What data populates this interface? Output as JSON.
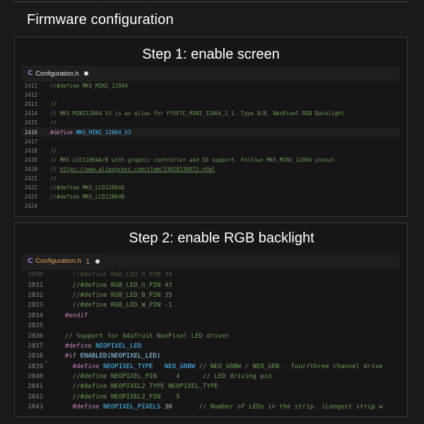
{
  "page": {
    "title": "Firmware configuration"
  },
  "steps": [
    {
      "title": "Step 1: enable screen",
      "tab": {
        "icon": "C",
        "filename": "Configuration.h",
        "problems": "",
        "unsaved": true
      },
      "lines": [
        {
          "n": "2411",
          "segs": [
            {
              "t": "//#define MKS_MINI_12864",
              "c": "c-com"
            }
          ]
        },
        {
          "n": "2412",
          "segs": []
        },
        {
          "n": "2413",
          "segs": [
            {
              "t": "//",
              "c": "c-com"
            }
          ]
        },
        {
          "n": "2414",
          "segs": [
            {
              "t": "// MKS MINI12864 V3 is an alias for FYSETC_MINI_12864_2_1. Type A/B. NeoPixel RGB Backlight.",
              "c": "c-com"
            }
          ]
        },
        {
          "n": "2415",
          "segs": [
            {
              "t": "//",
              "c": "c-com"
            }
          ]
        },
        {
          "n": "2416",
          "current": true,
          "modified": true,
          "segs": [
            {
              "t": "#define ",
              "c": "c-pp"
            },
            {
              "t": "MKS_MINI_12864_V3",
              "c": "c-mac"
            }
          ]
        },
        {
          "n": "2417",
          "segs": []
        },
        {
          "n": "2418",
          "segs": [
            {
              "t": "//",
              "c": "c-com"
            }
          ]
        },
        {
          "n": "2419",
          "segs": [
            {
              "t": "// MKS LCD12864A/B with graphic controller and SD support. Follows MKS_MINI_12864 pinout.",
              "c": "c-com"
            }
          ]
        },
        {
          "n": "2420",
          "segs": [
            {
              "t": "// ",
              "c": "c-com"
            },
            {
              "t": "https://www.aliexpress.com/item/33018110072.html",
              "c": "c-link"
            }
          ]
        },
        {
          "n": "2421",
          "segs": [
            {
              "t": "//",
              "c": "c-com"
            }
          ]
        },
        {
          "n": "2422",
          "segs": [
            {
              "t": "//#define MKS_LCD12864A",
              "c": "c-com"
            }
          ]
        },
        {
          "n": "2423",
          "segs": [
            {
              "t": "//#define MKS_LCD12864B",
              "c": "c-com"
            }
          ]
        },
        {
          "n": "2424",
          "segs": []
        },
        {
          "n": "",
          "segs": [
            {
              "t": "..",
              "c": "c-ell"
            }
          ]
        }
      ]
    },
    {
      "title": "Step 2: enable RGB backlight",
      "tab": {
        "icon": "C",
        "filename": "Configuration.h",
        "problems": "1",
        "unsaved": true
      },
      "lines": [
        {
          "n": "2830",
          "dim": true,
          "segs": [
            {
              "t": "    //#define RGB_LED_R_PIN 34",
              "c": "c-com"
            }
          ]
        },
        {
          "n": "2831",
          "segs": [
            {
              "t": "    //#define RGB_LED_G_PIN 43",
              "c": "c-com"
            }
          ]
        },
        {
          "n": "2832",
          "segs": [
            {
              "t": "    //#define RGB_LED_B_PIN 35",
              "c": "c-com"
            }
          ]
        },
        {
          "n": "2833",
          "error": true,
          "segs": [
            {
              "t": "    //#define RGB_LED_W_PIN -1",
              "c": "c-com"
            }
          ]
        },
        {
          "n": "2834",
          "segs": [
            {
              "t": "  #endif",
              "c": "c-pp"
            }
          ]
        },
        {
          "n": "2835",
          "segs": []
        },
        {
          "n": "2836",
          "segs": [
            {
              "t": "  // Support for Adafruit NeoPixel LED driver",
              "c": "c-com"
            }
          ]
        },
        {
          "n": "2837",
          "modified": true,
          "segs": [
            {
              "t": "  #define ",
              "c": "c-pp"
            },
            {
              "t": "NEOPIXEL_LED",
              "c": "c-mac"
            }
          ]
        },
        {
          "n": "2838",
          "fold": true,
          "segs": [
            {
              "t": "  #if ",
              "c": "c-pp"
            },
            {
              "t": "ENABLED(NEOPIXEL_LED)",
              "c": "c-id"
            }
          ]
        },
        {
          "n": "2839",
          "segs": [
            {
              "t": "    #define ",
              "c": "c-pp"
            },
            {
              "t": "NEOPIXEL_TYPE   NEO_GRBW",
              "c": "c-mac"
            },
            {
              "t": " // NEO_GRBW / NEO_GRB - four/three channel drive",
              "c": "c-com"
            }
          ]
        },
        {
          "n": "2840",
          "segs": [
            {
              "t": "    //#define NEOPIXEL_PIN     4      // LED driving pin",
              "c": "c-com"
            }
          ]
        },
        {
          "n": "2841",
          "segs": [
            {
              "t": "    //#define NEOPIXEL2_TYPE NEOPIXEL_TYPE",
              "c": "c-com"
            }
          ]
        },
        {
          "n": "2842",
          "segs": [
            {
              "t": "    //#define NEOPIXEL2_PIN    5",
              "c": "c-com"
            }
          ]
        },
        {
          "n": "2843",
          "segs": [
            {
              "t": "    #define ",
              "c": "c-pp"
            },
            {
              "t": "NEOPIXEL_PIXELS ",
              "c": "c-mac"
            },
            {
              "t": "30",
              "c": "c-num"
            },
            {
              "t": "       // Number of LEDs in the strip. (Longest strip w",
              "c": "c-com"
            }
          ]
        }
      ]
    }
  ]
}
